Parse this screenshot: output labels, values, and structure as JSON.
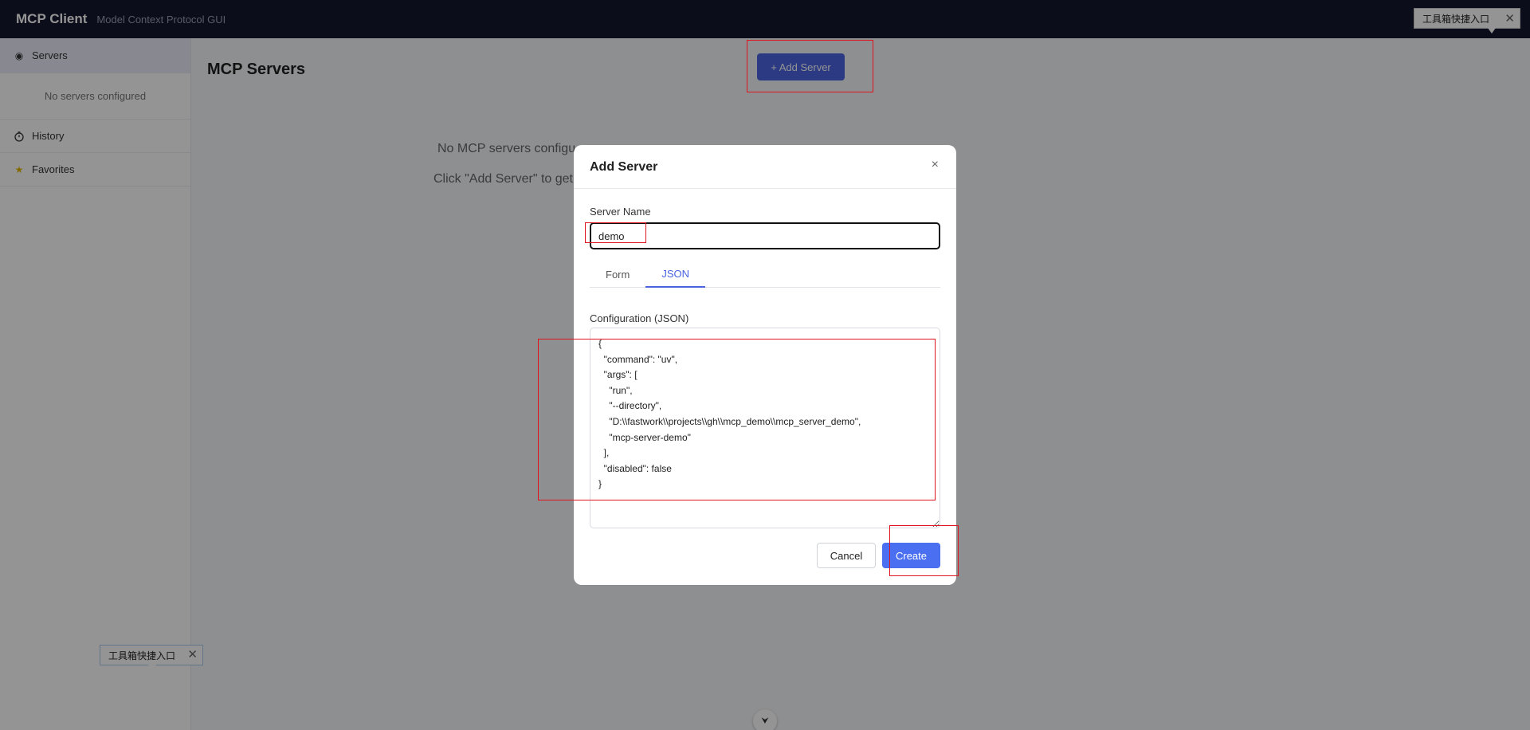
{
  "app": {
    "title": "MCP Client",
    "subtitle": "Model Context Protocol GUI"
  },
  "sidebar": {
    "items": [
      {
        "label": "Servers",
        "icon": "radio-dot-icon"
      },
      {
        "label": "History",
        "icon": "clock-icon"
      },
      {
        "label": "Favorites",
        "icon": "star-icon"
      }
    ],
    "empty_text": "No servers configured"
  },
  "main": {
    "title": "MCP Servers",
    "add_button": "+ Add Server",
    "empty_line1": "No MCP servers configu",
    "empty_line2": "Click \"Add Server\" to get"
  },
  "toolbox_tooltip": {
    "label": "工具箱快捷入口"
  },
  "modal": {
    "title": "Add Server",
    "close_glyph": "×",
    "server_name_label": "Server Name",
    "server_name_value": "demo",
    "tabs": [
      {
        "label": "Form",
        "active": false
      },
      {
        "label": "JSON",
        "active": true
      }
    ],
    "config_label": "Configuration (JSON)",
    "config_value": "{\n  \"command\": \"uv\",\n  \"args\": [\n    \"run\",\n    \"--directory\",\n    \"D:\\\\fastwork\\\\projects\\\\gh\\\\mcp_demo\\\\mcp_server_demo\",\n    \"mcp-server-demo\"\n  ],\n  \"disabled\": false\n}",
    "cancel_label": "Cancel",
    "create_label": "Create"
  },
  "colors": {
    "topbar": "#14172e",
    "accent": "#4a64e0",
    "annotation": "#e0141e"
  }
}
